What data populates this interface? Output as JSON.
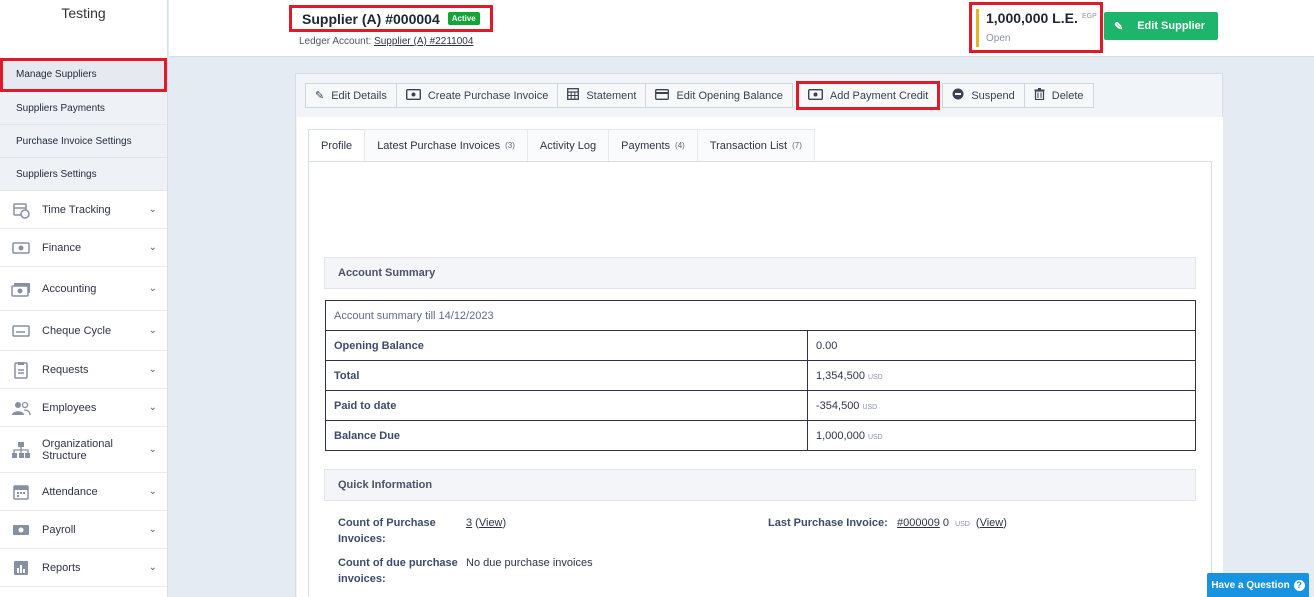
{
  "sidebar": {
    "brand": "Testing",
    "sub_items": [
      {
        "label": "Manage Suppliers"
      },
      {
        "label": "Suppliers Payments"
      },
      {
        "label": "Purchase Invoice Settings"
      },
      {
        "label": "Suppliers Settings"
      }
    ],
    "main_items": [
      {
        "label": "Time Tracking",
        "icon": "calendar-clock-icon"
      },
      {
        "label": "Finance",
        "icon": "cash-icon"
      },
      {
        "label": "Accounting",
        "icon": "money-stack-icon"
      },
      {
        "label": "Cheque Cycle",
        "icon": "cheque-icon"
      },
      {
        "label": "Requests",
        "icon": "clipboard-icon"
      },
      {
        "label": "Employees",
        "icon": "users-icon"
      },
      {
        "label": "Organizational Structure",
        "icon": "org-chart-icon"
      },
      {
        "label": "Attendance",
        "icon": "calendar-icon"
      },
      {
        "label": "Payroll",
        "icon": "payroll-icon"
      },
      {
        "label": "Reports",
        "icon": "bar-chart-icon"
      }
    ]
  },
  "header": {
    "supplier_title": "Supplier (A) #000004",
    "status_badge": "Active",
    "ledger_label": "Ledger Account:",
    "ledger_link": "Supplier (A) #2211004",
    "balance_amount": "1,000,000 L.E.",
    "balance_currency": "EGP",
    "balance_status": "Open",
    "edit_supplier_label": "Edit Supplier"
  },
  "toolbar": {
    "edit_details": "Edit Details",
    "create_purchase_invoice": "Create Purchase Invoice",
    "statement": "Statement",
    "edit_opening_balance": "Edit Opening Balance",
    "add_payment_credit": "Add Payment Credit",
    "suspend": "Suspend",
    "delete": "Delete"
  },
  "tabs": [
    {
      "label": "Profile",
      "count": ""
    },
    {
      "label": "Latest Purchase Invoices",
      "count": "(3)"
    },
    {
      "label": "Activity Log",
      "count": ""
    },
    {
      "label": "Payments",
      "count": "(4)"
    },
    {
      "label": "Transaction List",
      "count": "(7)"
    }
  ],
  "account_summary": {
    "heading": "Account Summary",
    "table_header": "Account summary till 14/12/2023",
    "rows": [
      {
        "label": "Opening Balance",
        "value": "0.00",
        "currency": ""
      },
      {
        "label": "Total",
        "value": "1,354,500",
        "currency": "USD"
      },
      {
        "label": "Paid to date",
        "value": "-354,500",
        "currency": "USD"
      },
      {
        "label": "Balance Due",
        "value": "1,000,000",
        "currency": "USD"
      }
    ]
  },
  "quick_info": {
    "heading": "Quick Information",
    "count_invoices_label": "Count of Purchase Invoices:",
    "count_invoices_value": "3",
    "view_label": "View",
    "count_due_label": "Count of due purchase invoices:",
    "count_due_value": "No due purchase invoices",
    "last_invoice_label": "Last Purchase Invoice:",
    "last_invoice_link": "#000009",
    "last_invoice_amount": "0",
    "last_invoice_currency": "USD"
  },
  "help": {
    "label": "Have a Question"
  }
}
